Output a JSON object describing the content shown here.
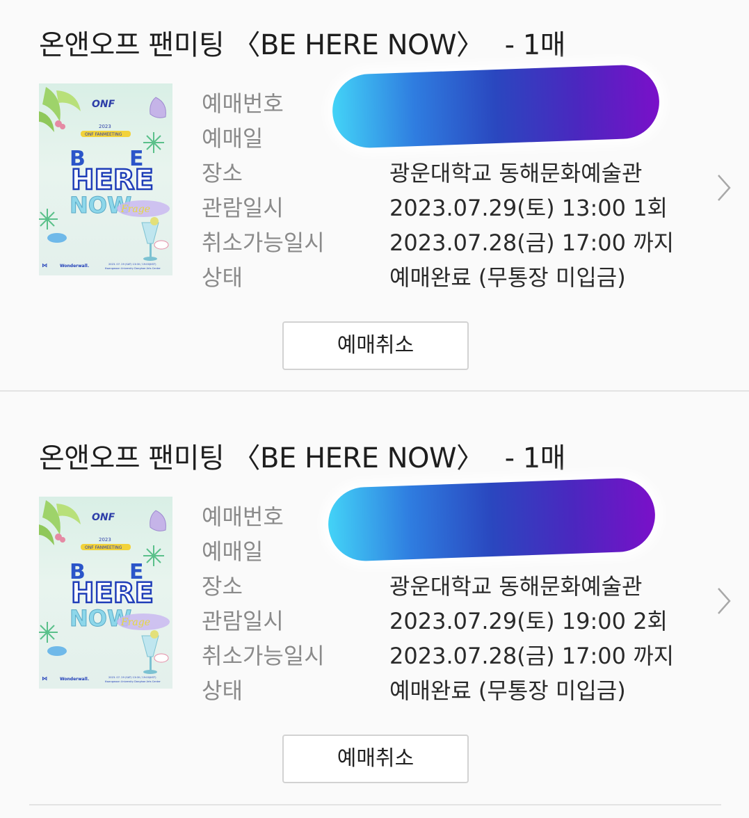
{
  "bookings": [
    {
      "title": "온앤오프 팬미팅 〈BE HERE NOW〉",
      "quantity": "- 1매",
      "labels": {
        "booking_number": "예매번호",
        "booking_date": "예매일",
        "venue": "장소",
        "show_datetime": "관람일시",
        "cancel_deadline": "취소가능일시",
        "status": "상태"
      },
      "venue": "광운대학교 동해문화예술관",
      "show_datetime": "2023.07.29(토) 13:00 1회",
      "cancel_deadline": "2023.07.28(금) 17:00 까지",
      "status": "예매완료 (무통장 미입금)",
      "cancel_button": "예매취소"
    },
    {
      "title": "온앤오프 팬미팅 〈BE HERE NOW〉",
      "quantity": "- 1매",
      "labels": {
        "booking_number": "예매번호",
        "booking_date": "예매일",
        "venue": "장소",
        "show_datetime": "관람일시",
        "cancel_deadline": "취소가능일시",
        "status": "상태"
      },
      "venue": "광운대학교 동해문화예술관",
      "show_datetime": "2023.07.29(토) 19:00 2회",
      "cancel_deadline": "2023.07.28(금) 17:00 까지",
      "status": "예매완료 (무통장 미입금)",
      "cancel_button": "예매취소"
    }
  ],
  "poster": {
    "brand": "ONF",
    "year": "2023",
    "subtitle": "ONF FANMEETING",
    "headline": "HERE",
    "headline2": "NOW",
    "footer": "Wonderwall.",
    "date_line": "2023. 07. 29 (SAT) 13:00 / 19:00(KST)",
    "venue_line": "Kwangwoon University Donghae Arts Center"
  },
  "colors": {
    "redaction_start": "#43d3f7",
    "redaction_end": "#7a10c9",
    "label_gray": "#8a8a8a"
  },
  "icons": {
    "chevron": "chevron-right-icon"
  }
}
